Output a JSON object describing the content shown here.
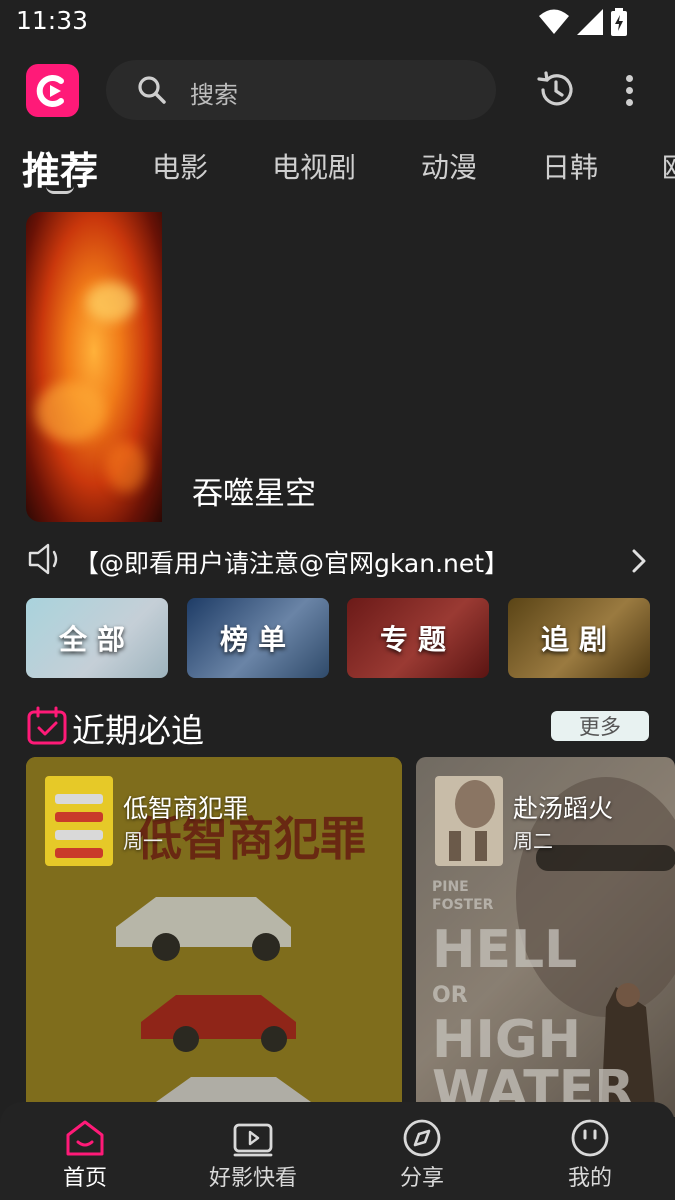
{
  "status_bar": {
    "time": "11:33"
  },
  "header": {
    "search_placeholder": "搜索"
  },
  "tabs": [
    {
      "label": "推荐",
      "active": true
    },
    {
      "label": "电影"
    },
    {
      "label": "电视剧"
    },
    {
      "label": "动漫"
    },
    {
      "label": "日韩"
    },
    {
      "label": "欧"
    }
  ],
  "banner": {
    "title": "吞噬星空"
  },
  "notice": {
    "text": "【@即看用户请注意@官网gkan.net】"
  },
  "quick_buttons": {
    "all": "全部",
    "rank": "榜单",
    "topic": "专题",
    "follow": "追剧"
  },
  "section": {
    "title": "近期必追",
    "more": "更多"
  },
  "cards": [
    {
      "title": "低智商犯罪",
      "day": "周一",
      "poster_text": "低智商犯罪"
    },
    {
      "title": "赴汤蹈火",
      "day": "周二",
      "poster_text_lines": [
        "PINE",
        "FOSTER",
        "HELL",
        "OR",
        "HIGH",
        "WATER"
      ]
    }
  ],
  "bottom_nav": [
    {
      "label": "首页",
      "icon": "home-icon",
      "active": true
    },
    {
      "label": "好影快看",
      "icon": "video-play-icon"
    },
    {
      "label": "分享",
      "icon": "compass-icon"
    },
    {
      "label": "我的",
      "icon": "profile-face-icon"
    }
  ],
  "colors": {
    "accent": "#ff1a78",
    "background": "#212121"
  }
}
